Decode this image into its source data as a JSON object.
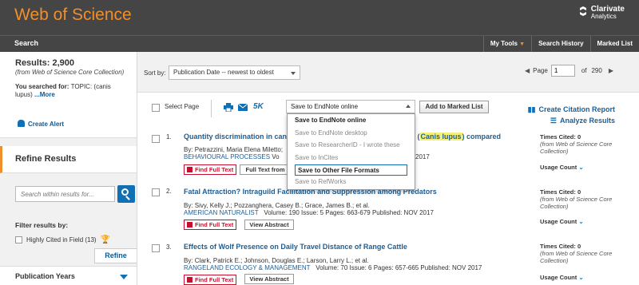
{
  "header": {
    "brand": "Web of Science",
    "company_line1": "Clarivate",
    "company_line2": "Analytics"
  },
  "nav": {
    "search": "Search",
    "my_tools": "My Tools",
    "search_history": "Search History",
    "marked_list": "Marked List"
  },
  "colors": {
    "brand_orange": "#f08f2c",
    "header_bg": "#454545",
    "link_blue": "#1d5e95",
    "accent_blue": "#1170b3",
    "full_text_red": "#c8102e"
  },
  "sidebar": {
    "results_title": "Results: 2,900",
    "results_source": "(from Web of Science Core Collection)",
    "searched_prefix": "You searched for: ",
    "searched_topic": "TOPIC: (canis lupus)",
    "more_link": " ...More",
    "create_alert": "Create Alert",
    "refine_heading": "Refine Results",
    "within_placeholder": "Search within results for...",
    "filter_heading": "Filter results by:",
    "highly_cited": "Highly Cited in Field (13)",
    "refine_button": "Refine",
    "pub_years": "Publication Years"
  },
  "sortbar": {
    "sort_label": "Sort by:",
    "sort_value": "Publication Date -- newest to oldest",
    "page_label": "Page",
    "page_value": "1",
    "of_label": "of",
    "total_pages": "290"
  },
  "toolbar": {
    "select_page": "Select Page",
    "five_k": "5K",
    "save_value": "Save to EndNote online",
    "add_marked": "Add to Marked List",
    "citation_report": "Create Citation Report",
    "analyze": "Analyze Results"
  },
  "save_menu": {
    "items": [
      "Save to EndNote online",
      "Save to EndNote desktop",
      "Save to ResearcherID - I wrote these",
      "Save to InCites",
      "Save to Other File Formats",
      "Save to RefWorks"
    ],
    "highlighted": "Save to Other File Formats"
  },
  "records": [
    {
      "num": "1.",
      "title_pre": "Quantity discrimination in can",
      "title_post": "s (",
      "title_hl": "Canis lupus",
      "title_end": ") compared",
      "authors": "By: Petrazzini, Maria Elena Miletto; ",
      "journal": "BEHAVIOURAL PROCESSES",
      "meta": "Vo",
      "meta_end": "2017",
      "full_text": "Find Full Text",
      "second_btn": "Full Text from",
      "times_cited": "Times Cited: 0",
      "tc_source": "(from Web of Science Core Collection)",
      "usage": "Usage Count"
    },
    {
      "num": "2.",
      "title": "Fatal Attraction? Intraguild Facilitation and Suppression among Predators",
      "authors": "By: Sivy, Kelly J.; Pozzanghera, Casey B.; Grace, James B.; et al.",
      "journal": "AMERICAN NATURALIST",
      "meta": "Volume: 190   Issue: 5   Pages: 663-679   Published: NOV 2017",
      "full_text": "Find Full Text",
      "second_btn": "View Abstract",
      "times_cited": "Times Cited: 0",
      "tc_source": "(from Web of Science Core Collection)",
      "usage": "Usage Count"
    },
    {
      "num": "3.",
      "title": "Effects of Wolf Presence on Daily Travel Distance of Range Cattle",
      "authors": "By: Clark, Patrick E.; Johnson, Douglas E.; Larson, Larry L.; et al.",
      "journal": "RANGELAND ECOLOGY & MANAGEMENT",
      "meta": "Volume: 70   Issue: 6   Pages: 657-665   Published: NOV 2017",
      "full_text": "Find Full Text",
      "second_btn": "View Abstract",
      "times_cited": "Times Cited: 0",
      "tc_source": "(from Web of Science Core Collection)",
      "usage": "Usage Count"
    }
  ]
}
